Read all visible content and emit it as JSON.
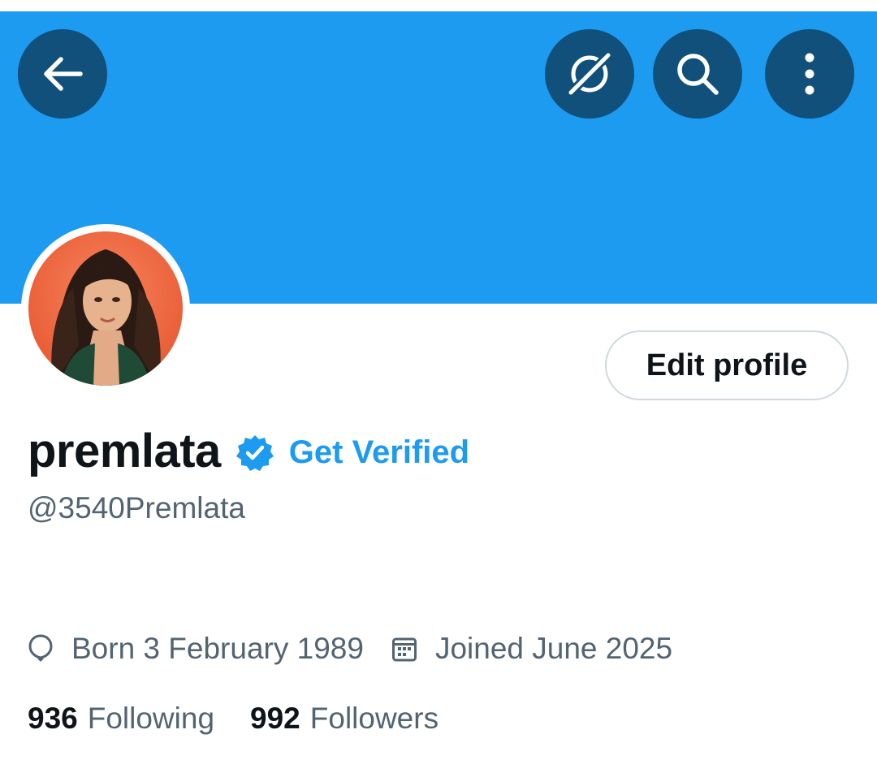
{
  "profile": {
    "display_name": "premlata",
    "handle": "@3540Premlata",
    "get_verified_label": "Get Verified",
    "edit_profile_label": "Edit profile",
    "born": "Born 3 February 1989",
    "joined": "Joined June 2025",
    "following_count": "936",
    "following_label": "Following",
    "followers_count": "992",
    "followers_label": "Followers"
  },
  "header": {
    "buttons": [
      {
        "icon": "back-arrow-icon"
      },
      {
        "icon": "grok-icon"
      },
      {
        "icon": "search-icon"
      },
      {
        "icon": "more-vertical-icon"
      }
    ]
  },
  "colors": {
    "banner": "#1d9bf0",
    "header_button": "#10507b",
    "accent": "#1d9bf0",
    "primary_text": "#0f1419",
    "secondary_text": "#536471"
  }
}
